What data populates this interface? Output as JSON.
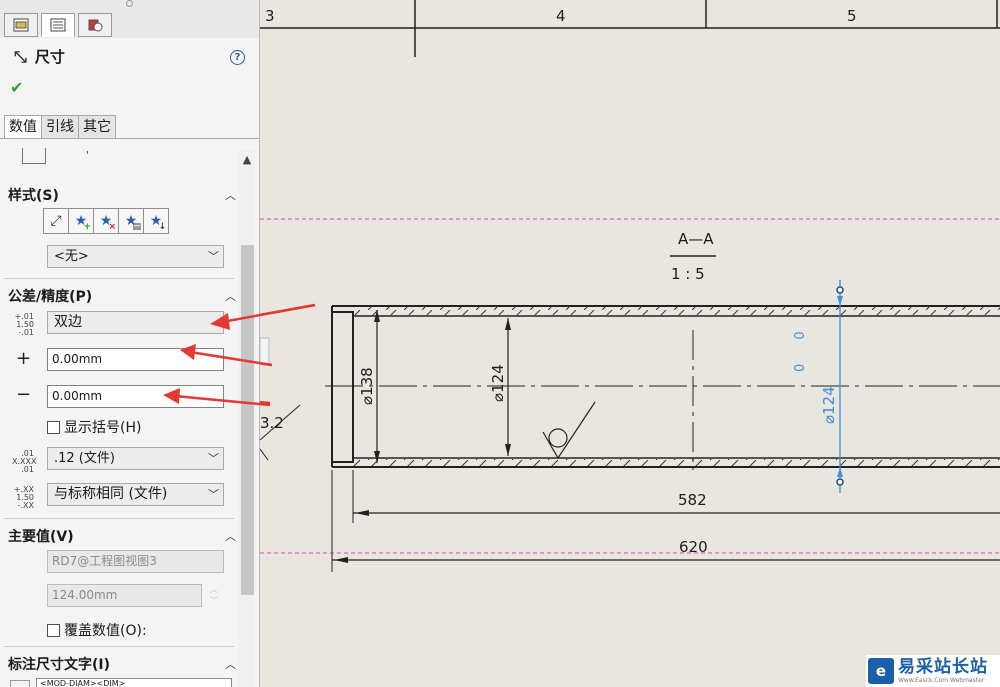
{
  "panel": {
    "tabs": [
      {
        "name": "feature-manager",
        "icon": "feature-tree-icon"
      },
      {
        "name": "property-manager",
        "icon": "property-manager-icon"
      },
      {
        "name": "configuration-manager",
        "icon": "configuration-icon"
      }
    ],
    "title": "尺寸",
    "title_icon": "dimension-icon",
    "subtabs": [
      "数值",
      "引线",
      "其它"
    ],
    "style_section": {
      "heading": "样式(S)",
      "buttons": [
        "apply-defaults-icon",
        "add-style-icon",
        "delete-style-icon",
        "save-style-icon",
        "load-style-icon"
      ],
      "selected_style": "<无>"
    },
    "tolerance_section": {
      "heading": "公差/精度(P)",
      "tolerance_type": "双边",
      "tolerance_icon_text": [
        "+.01",
        "1.50",
        "-.01"
      ],
      "upper_sign": "+",
      "upper_value": "0.00mm",
      "lower_sign": "−",
      "lower_value": "0.00mm",
      "show_parentheses_label": "显示括号(H)",
      "show_parentheses_checked": false,
      "primary_precision": ".12 (文件)",
      "primary_precision_icon_text": [
        ".01",
        "X.XXX",
        ".01"
      ],
      "tolerance_precision": "与标称相同 (文件)",
      "tolerance_precision_icon_text": [
        "+.XX",
        "1.50",
        "-.XX"
      ]
    },
    "primary_value_section": {
      "heading": "主要值(V)",
      "dimension_name": "RD7@工程图视图3",
      "dimension_value": "124.00mm",
      "override_label": "覆盖数值(O):",
      "override_checked": false
    },
    "dim_text_section": {
      "heading": "标注尺寸文字(I)",
      "text_value": "<MOD-DIAM><DIM>"
    }
  },
  "drawing": {
    "column_numbers": [
      "3",
      "4",
      "5"
    ],
    "section_label": "A—A",
    "scale_label": "1 : 5",
    "dimensions": {
      "outer_diameter": "138",
      "inner_diameter": "124",
      "selected_diameter": "124",
      "selected_tolerance": "0 0",
      "length_inner": "582",
      "length_total": "620",
      "partial_left": "3.2"
    },
    "colors": {
      "selected_dimension": "#3a8fe0",
      "sheet_border": "#e040e0",
      "annotation_arrow": "#e53935"
    }
  },
  "watermark": {
    "logo_glyph": "e",
    "text": "易采站长站",
    "subtext": "Www.Easck.Com Webmaster"
  }
}
